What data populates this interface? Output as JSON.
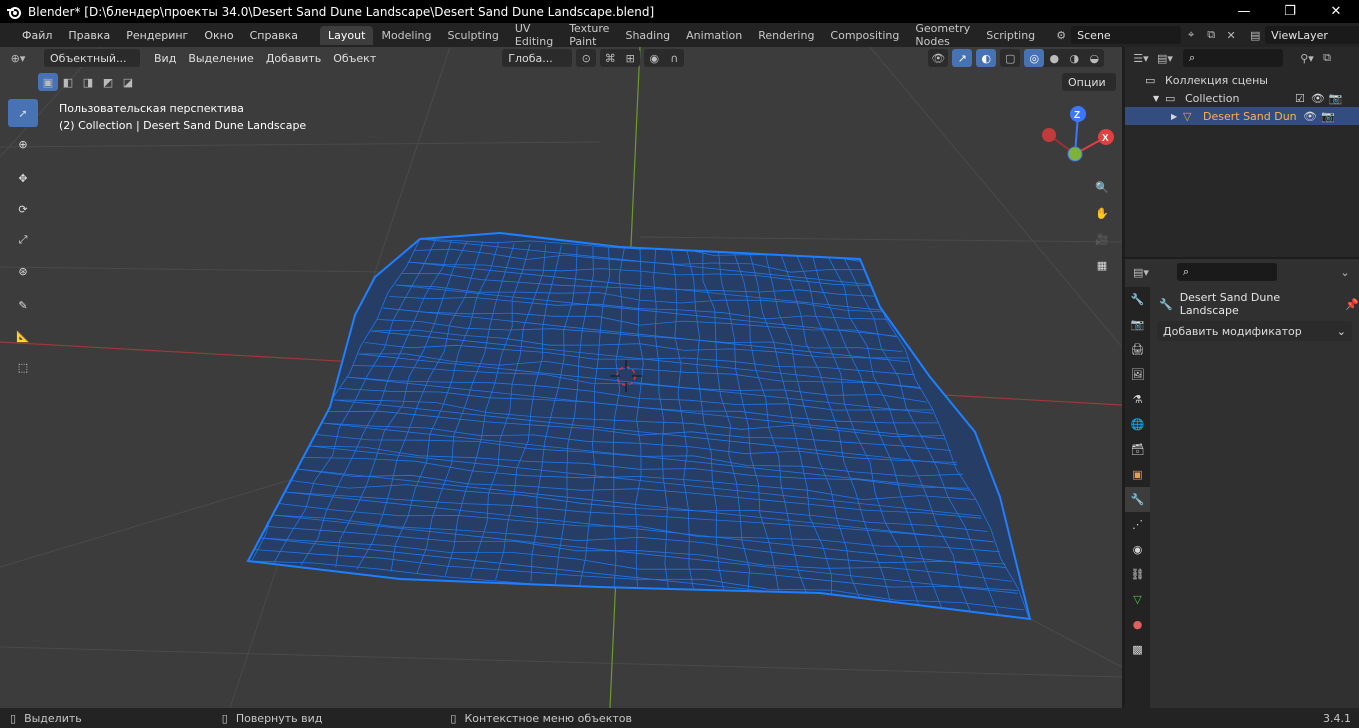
{
  "window": {
    "title": "Blender* [D:\\блендер\\проекты 34.0\\Desert Sand Dune Landscape\\Desert Sand Dune Landscape.blend]"
  },
  "menu": [
    "Файл",
    "Правка",
    "Рендеринг",
    "Окно",
    "Справка"
  ],
  "workspaces": [
    "Layout",
    "Modeling",
    "Sculpting",
    "UV Editing",
    "Texture Paint",
    "Shading",
    "Animation",
    "Rendering",
    "Compositing",
    "Geometry Nodes",
    "Scripting"
  ],
  "active_workspace": "Layout",
  "scene": {
    "name": "Scene"
  },
  "view_layer": {
    "name": "ViewLayer"
  },
  "viewport": {
    "mode": "Объектный...",
    "menus": [
      "Вид",
      "Выделение",
      "Добавить",
      "Объект"
    ],
    "transform_orientation": "Глоба...",
    "options_label": "Опции",
    "perspective_label": "Пользовательская перспектива",
    "collection_label": "(2) Collection | Desert Sand Dune Landscape",
    "gizmo": {
      "z": "Z",
      "x": "X"
    },
    "colors": {
      "mesh": "#1f7fff",
      "x_axis": "#c23b3b",
      "y_axis": "#7fb23a",
      "bg": "#3c3c3c"
    }
  },
  "outliner": {
    "scene_collection": "Коллекция сцены",
    "collection": "Collection",
    "object": "Desert Sand Dune La"
  },
  "properties": {
    "object_name": "Desert Sand Dune Landscape",
    "add_modifier": "Добавить модификатор"
  },
  "status": {
    "select": "Выделить",
    "rotate": "Повернуть вид",
    "context_menu": "Контекстное меню объектов",
    "version": "3.4.1"
  }
}
